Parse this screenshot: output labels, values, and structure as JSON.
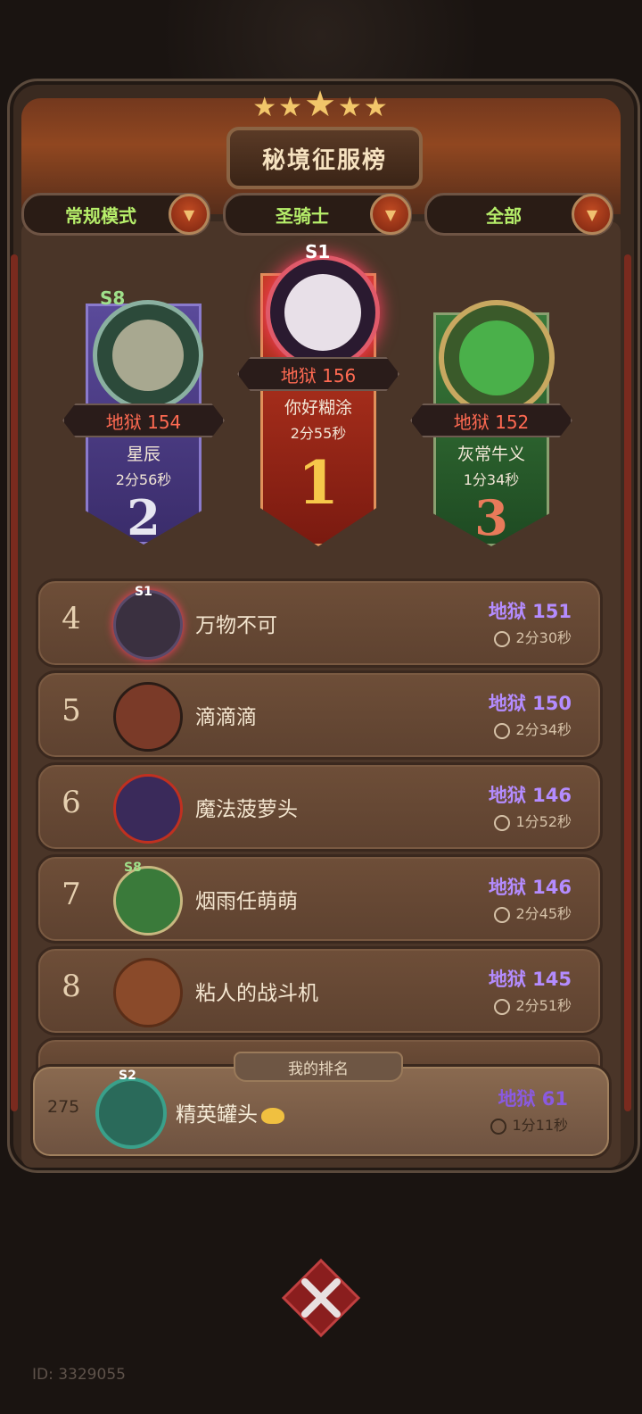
{
  "title": "秘境征服榜",
  "filters": [
    {
      "label": "常规模式"
    },
    {
      "label": "圣骑士"
    },
    {
      "label": "全部"
    }
  ],
  "podium": [
    {
      "rank": "1",
      "season": "S1",
      "level": "地狱 156",
      "name": "你好糊涂",
      "time": "2分55秒"
    },
    {
      "rank": "2",
      "season": "S8",
      "level": "地狱 154",
      "name": "星辰",
      "time": "2分56秒"
    },
    {
      "rank": "3",
      "season": "",
      "level": "地狱 152",
      "name": "灰常牛义",
      "time": "1分34秒"
    }
  ],
  "list": [
    {
      "rank": "4",
      "season": "S1",
      "name": "万物不可",
      "level": "地狱 151",
      "time": "2分30秒"
    },
    {
      "rank": "5",
      "season": "",
      "name": "滴滴滴",
      "level": "地狱 150",
      "time": "2分34秒"
    },
    {
      "rank": "6",
      "season": "",
      "name": "魔法菠萝头",
      "level": "地狱 146",
      "time": "1分52秒"
    },
    {
      "rank": "7",
      "season": "S8",
      "name": "烟雨任萌萌",
      "level": "地狱 146",
      "time": "2分45秒"
    },
    {
      "rank": "8",
      "season": "",
      "name": "粘人的战斗机",
      "level": "地狱 145",
      "time": "2分51秒"
    }
  ],
  "my_rank": {
    "tab_label": "我的排名",
    "rank": "275",
    "season": "S2",
    "name": "精英罐头",
    "level": "地狱 61",
    "time": "1分11秒"
  },
  "player_id": "ID: 3329055",
  "colors": {
    "level_red": "#ff6a52",
    "level_purple": "#b48cff",
    "filter_green": "#b6ee6a"
  }
}
